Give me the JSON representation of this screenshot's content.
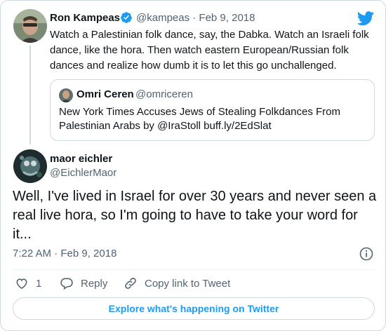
{
  "parent_tweet": {
    "author_name": "Ron Kampeas",
    "handle_date": "@kampeas · Feb 9, 2018",
    "text": "Watch a Palestinian folk dance, say, the Dabka. Watch an Israeli folk dance, like the hora. Then watch eastern European/Russian folk dances and realize how dumb it is to let this go unchallenged.",
    "verified_icon": "verified-badge-icon",
    "quoted": {
      "author_name": "Omri Ceren",
      "handle": "@omriceren",
      "text": "New York Times Accuses Jews of Stealing Folkdances From Palestinian Arabs by @IraStoll  buff.ly/2EdSlat"
    }
  },
  "main_tweet": {
    "author_name": "maor eichler",
    "handle": "@EichlerMaor",
    "text": "Well, I've lived in Israel for over 30 years and never seen a real live hora, so I'm going to have to take your word for it...",
    "timestamp": "7:22 AM · Feb 9, 2018"
  },
  "actions": {
    "like_count": "1",
    "reply_label": "Reply",
    "copy_label": "Copy link to Tweet"
  },
  "explore_label": "Explore what's happening on Twitter",
  "colors": {
    "brand_blue": "#1d9bf0",
    "text_primary": "#0f1419",
    "text_secondary": "#536471",
    "border": "#cfd9de"
  },
  "icons": [
    "twitter-bird-icon",
    "verified-badge-icon",
    "info-icon",
    "heart-icon",
    "reply-bubble-icon",
    "link-icon"
  ]
}
